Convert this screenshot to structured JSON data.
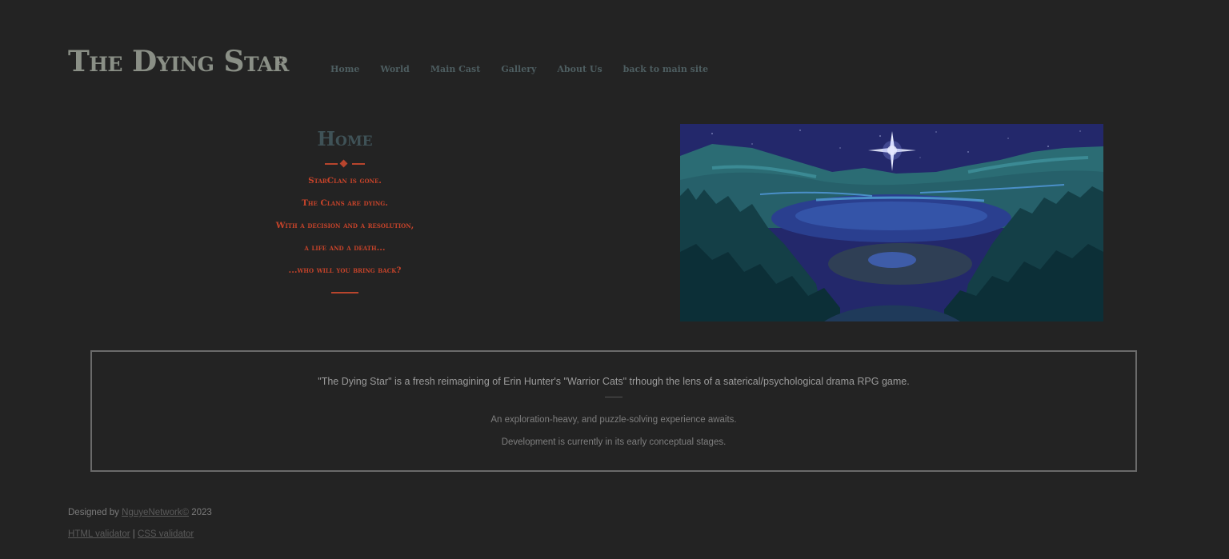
{
  "header": {
    "title": "The Dying Star",
    "star_glyph": "✫",
    "nav": [
      {
        "label": "Home"
      },
      {
        "label": "World"
      },
      {
        "label": "Main Cast"
      },
      {
        "label": "Gallery"
      },
      {
        "label": "About Us"
      },
      {
        "label": "back to main site"
      }
    ]
  },
  "intro": {
    "heading": "Home",
    "verses": [
      "StarClan is gone.",
      "The Clans are dying.",
      "With a decision and a resolution,",
      "a life and a death...",
      "...who will you bring back?"
    ]
  },
  "hero": {
    "icon": "landscape-illustration",
    "colors": {
      "sky": "#23286b",
      "mountains": "#2b6c74",
      "lake": "#2a3f8f",
      "forest": "#0f3a42",
      "star": "#e8ecff"
    }
  },
  "about": {
    "main": "\"The Dying Star\" is a fresh reimagining of Erin Hunter's \"Warrior Cats\" trhough the lens of a saterical/psychological drama RPG game.",
    "line1": "An exploration-heavy, and puzzle-solving experience awaits.",
    "line2": "Development is currently in its early conceptual stages."
  },
  "footer": {
    "designed_by": "Designed by",
    "author_link": "NguyeNetwork©",
    "year": "2023",
    "html_validator": "HTML validator",
    "separator": "|",
    "css_validator": "CSS validator"
  },
  "colors": {
    "background": "#232323",
    "accent_red": "#c5432a",
    "heading_teal": "#3f5257",
    "title_gray": "#8a8f86"
  }
}
